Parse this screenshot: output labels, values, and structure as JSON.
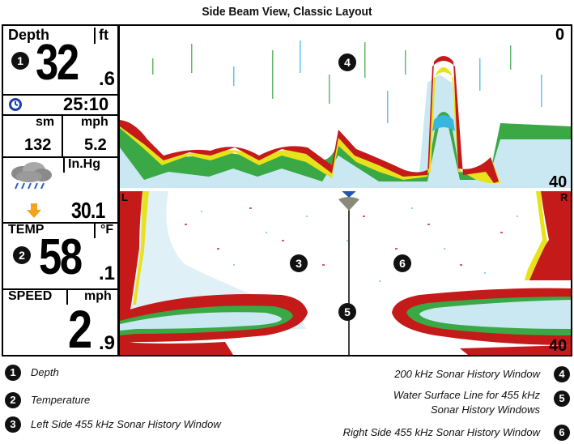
{
  "title": "Side Beam View, Classic Layout",
  "panel": {
    "depth_label": "Depth",
    "depth_unit": "ft",
    "depth_value": "32",
    "depth_decimal": ".6",
    "timer_value": "25:10",
    "distance_unit": "sm",
    "speed_unit_small": "mph",
    "distance_value": "132",
    "speed_small_value": "5.2",
    "pressure_unit": "In.Hg",
    "pressure_value": "30.1",
    "temp_label": "TEMP",
    "temp_unit": "°F",
    "temp_value": "58",
    "temp_decimal": ".1",
    "speed_label": "SPEED",
    "speed_unit": "mph",
    "speed_value": "2",
    "speed_decimal": ".9"
  },
  "sonar": {
    "top_scale_zero": "0",
    "top_scale_max": "40",
    "left_marker": "L",
    "right_marker": "R",
    "bottom_scale_max": "40"
  },
  "callouts": [
    "1",
    "2",
    "3",
    "4",
    "5",
    "6"
  ],
  "legend": {
    "item1": "Depth",
    "item2": "Temperature",
    "item3": "Left Side 455 kHz Sonar History Window",
    "item4": "200 kHz Sonar History Window",
    "item5_line1": "Water Surface Line for 455 kHz",
    "item5_line2": "Sonar History Windows",
    "item6": "Right Side 455 kHz Sonar History Window"
  },
  "colors": {
    "sonar_red": "#c41a1a",
    "sonar_orange": "#f39a19",
    "sonar_yellow": "#e8e21c",
    "sonar_green": "#3aa844",
    "sonar_cyan": "#38b6e0",
    "boat_marker": "#1e56b4"
  }
}
